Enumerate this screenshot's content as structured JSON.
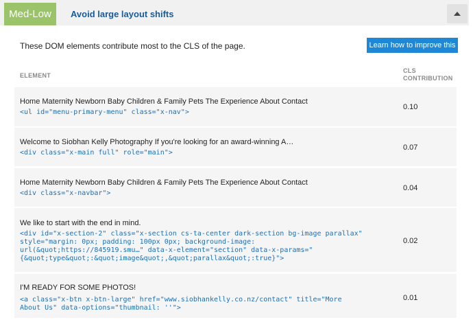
{
  "audit": {
    "severity": "Med-Low",
    "title": "Avoid large layout shifts",
    "description": "These DOM elements contribute most to the CLS of the page.",
    "learn_button": "Learn how to improve this",
    "collapse_icon": "chevron-up-icon"
  },
  "table": {
    "headers": {
      "element": "ELEMENT",
      "cls_line1": "CLS",
      "cls_line2": "CONTRIBUTION"
    },
    "rows": [
      {
        "text": "Home Maternity Newborn Baby Children & Family Pets The Experience About Contact",
        "code": [
          "<ul id=\"menu-primary-menu\" class=\"x-nav\">"
        ],
        "value": "0.10"
      },
      {
        "text": "Welcome to Siobhan Kelly Photography If you're looking for an award-winning A…",
        "code": [
          "<div class=\"x-main full\" role=\"main\">"
        ],
        "value": "0.07"
      },
      {
        "text": "Home Maternity Newborn Baby Children & Family Pets The Experience About Contact",
        "code": [
          "<div class=\"x-navbar\">"
        ],
        "value": "0.04"
      },
      {
        "text": "We like to start with the end in mind.",
        "code": [
          "<div id=\"x-section-2\" class=\"x-section cs-ta-center dark-section bg-image parallax\"",
          "style=\"margin: 0px; padding: 100px 0px; background-image:",
          "url(&quot;https://845919.smu…\" data-x-element=\"section\" data-x-params=\"",
          "{&quot;type&quot;:&quot;image&quot;,&quot;parallax&quot;:true}\">"
        ],
        "value": "0.02"
      },
      {
        "text": "I'M READY FOR SOME PHOTOS!",
        "code": [
          "<a class=\"x-btn x-btn-large\" href=\"www.siobhankelly.co.nz/contact\" title=\"More",
          "About Us\" data-options=\"thumbnail: ''\">"
        ],
        "value": "0.01"
      }
    ]
  }
}
